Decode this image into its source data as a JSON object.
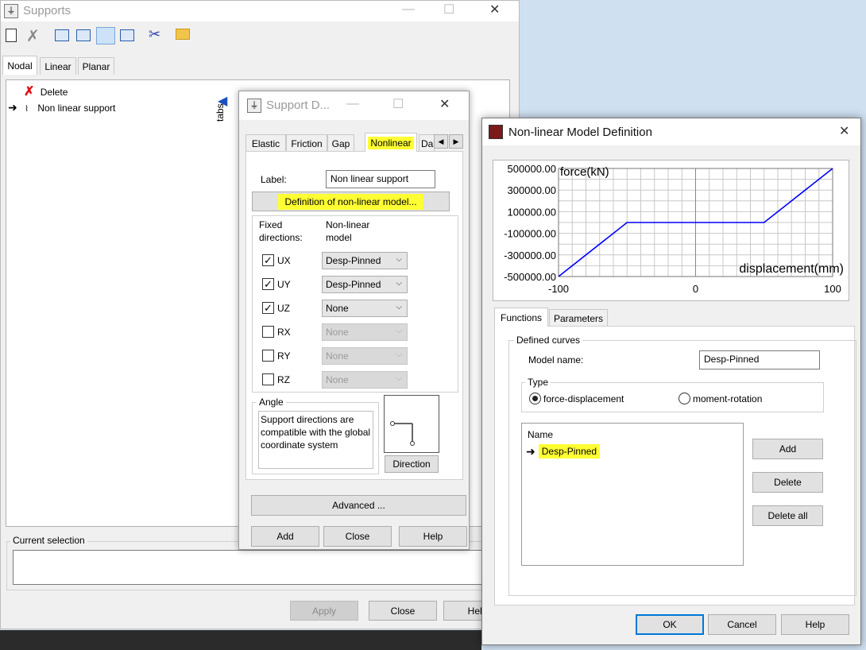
{
  "supports_window": {
    "title": "Supports",
    "tabs": [
      "Nodal",
      "Linear",
      "Planar"
    ],
    "list_items": [
      "Delete",
      "Non linear support"
    ],
    "tabs_label": "tabs",
    "current_selection_label": "Current selection",
    "apply_label": "Apply",
    "close_label": "Close",
    "help_label": "Help"
  },
  "support_dialog": {
    "title": "Support D...",
    "tabs": [
      "Elastic",
      "Friction",
      "Gap",
      "Nonlinear",
      "Da"
    ],
    "label_caption": "Label:",
    "label_value": "Non linear support",
    "definition_button": "Definition of non-linear model...",
    "fixed_directions": "Fixed directions:",
    "nonlinear_model": "Non-linear model",
    "rows": [
      {
        "name": "UX",
        "checked": true,
        "model": "Desp-Pinned",
        "enabled": true
      },
      {
        "name": "UY",
        "checked": true,
        "model": "Desp-Pinned",
        "enabled": true
      },
      {
        "name": "UZ",
        "checked": true,
        "model": "None",
        "enabled": true
      },
      {
        "name": "RX",
        "checked": false,
        "model": "None",
        "enabled": false
      },
      {
        "name": "RY",
        "checked": false,
        "model": "None",
        "enabled": false
      },
      {
        "name": "RZ",
        "checked": false,
        "model": "None",
        "enabled": false
      }
    ],
    "angle_title": "Angle",
    "angle_text": "Support directions are compatible with the global coordinate system",
    "direction_button": "Direction",
    "advanced_button": "Advanced ...",
    "add_button": "Add",
    "close_button": "Close",
    "help_button": "Help",
    "highlight_color": "#ffff33"
  },
  "nonlinear_dialog": {
    "title": "Non-linear Model Definition",
    "tabs": [
      "Functions",
      "Parameters"
    ],
    "defined_curves": "Defined curves",
    "model_name_label": "Model name:",
    "model_name_value": "Desp-Pinned",
    "type_label": "Type",
    "type_options": [
      "force-displacement",
      "moment-rotation"
    ],
    "type_selected": "force-displacement",
    "name_header": "Name",
    "curve_items": [
      "Desp-Pinned"
    ],
    "add_button": "Add",
    "delete_button": "Delete",
    "delete_all_button": "Delete all",
    "ok_button": "OK",
    "cancel_button": "Cancel",
    "help_button": "Help"
  },
  "chart_data": {
    "type": "line",
    "xlabel": "displacement(mm)",
    "ylabel": "force(kN)",
    "xlim": [
      -100,
      100
    ],
    "ylim": [
      -500000,
      500000
    ],
    "x_ticks": [
      "-100",
      "0",
      "100"
    ],
    "y_ticks": [
      "500000.00",
      "300000.00",
      "100000.00",
      "-100000.00",
      "-300000.00",
      "-500000.00"
    ],
    "grid": true,
    "line_color": "#0000ff",
    "series": [
      {
        "x": [
          -100,
          -50,
          50,
          100
        ],
        "y": [
          -500000,
          0,
          0,
          500000
        ]
      }
    ]
  }
}
